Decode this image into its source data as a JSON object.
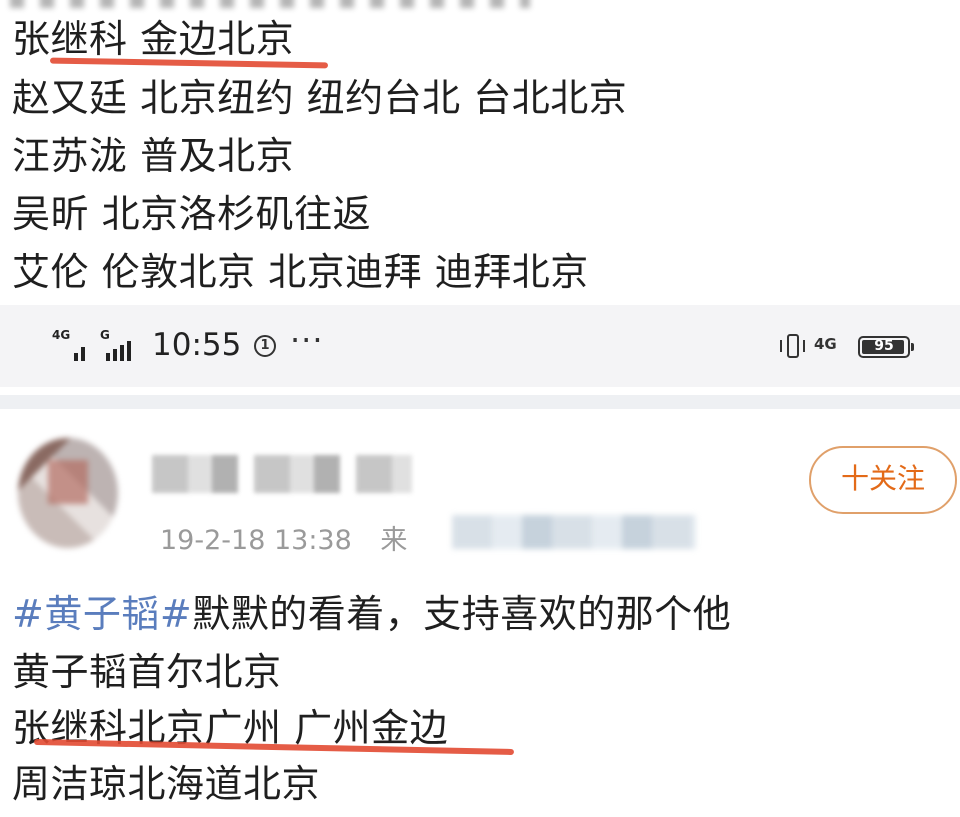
{
  "top_post": {
    "lines": [
      "张继科 金边北京",
      "赵又廷 北京纽约 纽约台北 台北北京",
      "汪苏泷 普及北京",
      "吴昕 北京洛杉矶往返",
      "艾伦 伦敦北京 北京迪拜 迪拜北京"
    ]
  },
  "status_bar": {
    "signal_1_label": "4G",
    "signal_2_label": "G",
    "time": "10:55",
    "notification_icon_text": "1",
    "more": "···",
    "right_network_label": "4G",
    "battery": "95",
    "battery_level_percent": 95
  },
  "post": {
    "timestamp": "19-2-18 13:38",
    "source_prefix": "来",
    "follow_label": "十关注",
    "hashtag": "#黄子韬#",
    "text_after_hashtag": "默默的看着，支持喜欢的那个他",
    "lines": [
      "黄子韬首尔北京",
      "张继科北京广州 广州金边",
      "周洁琼北海道北京"
    ]
  },
  "colors": {
    "underline": "#e24a32",
    "hashtag": "#5a7dbd",
    "follow": "#e36a18"
  }
}
